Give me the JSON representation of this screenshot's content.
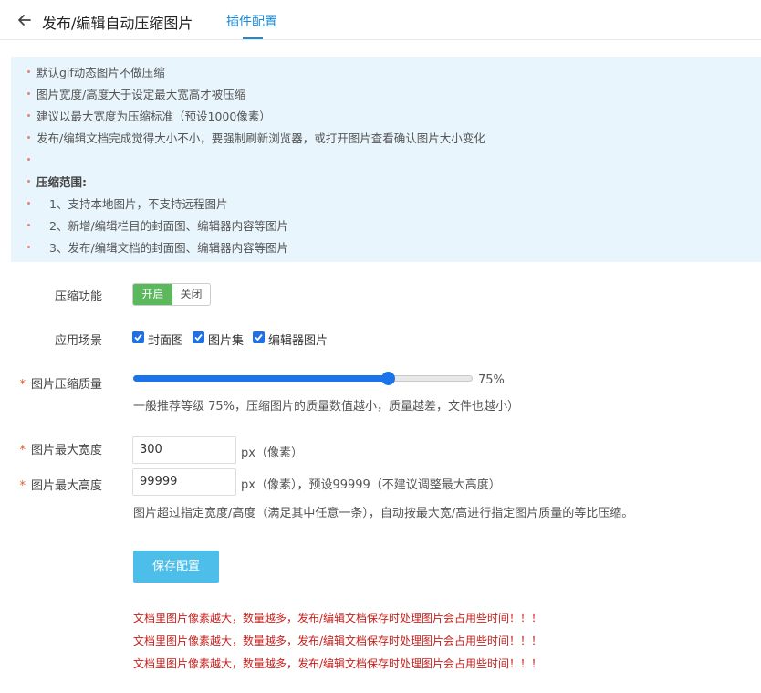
{
  "header": {
    "title": "发布/编辑自动压缩图片",
    "active_tab": "插件配置"
  },
  "notice": {
    "lines": [
      {
        "text": "默认gif动态图片不做压缩"
      },
      {
        "text": "图片宽度/高度大于设定最大宽高才被压缩"
      },
      {
        "text": "建议以最大宽度为压缩标准（预设1000像素）"
      },
      {
        "text": "发布/编辑文档完成觉得大小不小，要强制刷新浏览器，或打开图片查看确认图片大小变化"
      },
      {
        "text": ""
      },
      {
        "text": "压缩范围:"
      },
      {
        "text": "1、支持本地图片，不支持远程图片"
      },
      {
        "text": "2、新增/编辑栏目的封面图、编辑器内容等图片"
      },
      {
        "text": "3、发布/编辑文档的封面图、编辑器内容等图片"
      }
    ]
  },
  "form": {
    "compress": {
      "label": "压缩功能",
      "on_label": "开启",
      "off_label": "关闭",
      "state": "on"
    },
    "scene": {
      "label": "应用场景",
      "options": [
        {
          "label": "封面图",
          "checked": true
        },
        {
          "label": "图片集",
          "checked": true
        },
        {
          "label": "编辑器图片",
          "checked": true
        }
      ]
    },
    "quality": {
      "required_mark": "*",
      "label": "图片压缩质量",
      "value": 75,
      "value_text": "75%",
      "help": "一般推荐等级 75%，压缩图片的质量数值越小，质量越差，文件也越小）"
    },
    "max_width": {
      "required_mark": "*",
      "label": "图片最大宽度",
      "value": "300",
      "unit": "px（像素）"
    },
    "max_height": {
      "required_mark": "*",
      "label": "图片最大高度",
      "value": "99999",
      "unit": "px（像素），预设99999（不建议调整最大高度）",
      "help": "图片超过指定宽度/高度（满足其中任意一条），自动按最大宽/高进行指定图片质量的等比压缩。"
    },
    "save_label": "保存配置",
    "warnings": [
      "文档里图片像素越大，数量越多，发布/编辑文档保存时处理图片会占用些时间！！！",
      "文档里图片像素越大，数量越多，发布/编辑文档保存时处理图片会占用些时间！！！",
      "文档里图片像素越大，数量越多，发布/编辑文档保存时处理图片会占用些时间！！！"
    ]
  },
  "colors": {
    "accent": "#1c8ad6",
    "toggle_on": "#5cb85c",
    "slider": "#1a73e8",
    "save_button": "#4dbee9",
    "warning": "#c8211d",
    "notice_bg": "#e9f5fd"
  }
}
